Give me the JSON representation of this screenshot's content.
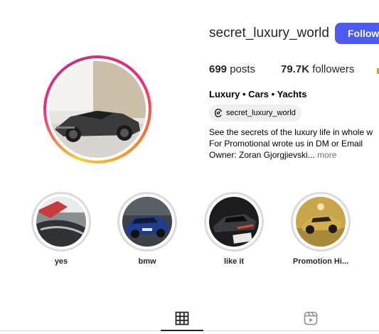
{
  "profile": {
    "username": "secret_luxury_world",
    "follow_label": "Follow",
    "posts_count": "699",
    "posts_label": "posts",
    "followers_count": "79.7K",
    "followers_label": "followers",
    "full_name": "Luxury • Cars • Yachts",
    "threads_handle": "secret_luxury_world",
    "bio_lines": [
      "See the secrets of the luxury life in whole w",
      "For Promotional wrote us in DM or Email",
      "Owner: Zoran Gjorgjievski..."
    ],
    "more_label": "more"
  },
  "highlights": [
    {
      "label": "yes"
    },
    {
      "label": "bmw"
    },
    {
      "label": "like it"
    },
    {
      "label": "Promotion Hi..."
    }
  ],
  "tabs": [
    {
      "icon": "grid-icon",
      "active": true
    },
    {
      "icon": "reels-icon",
      "active": false
    }
  ],
  "colors": {
    "follow_button": "#4c5bf5",
    "story_ring_gradient": [
      "#f9ce34",
      "#ee2a7b",
      "#c13584"
    ]
  }
}
